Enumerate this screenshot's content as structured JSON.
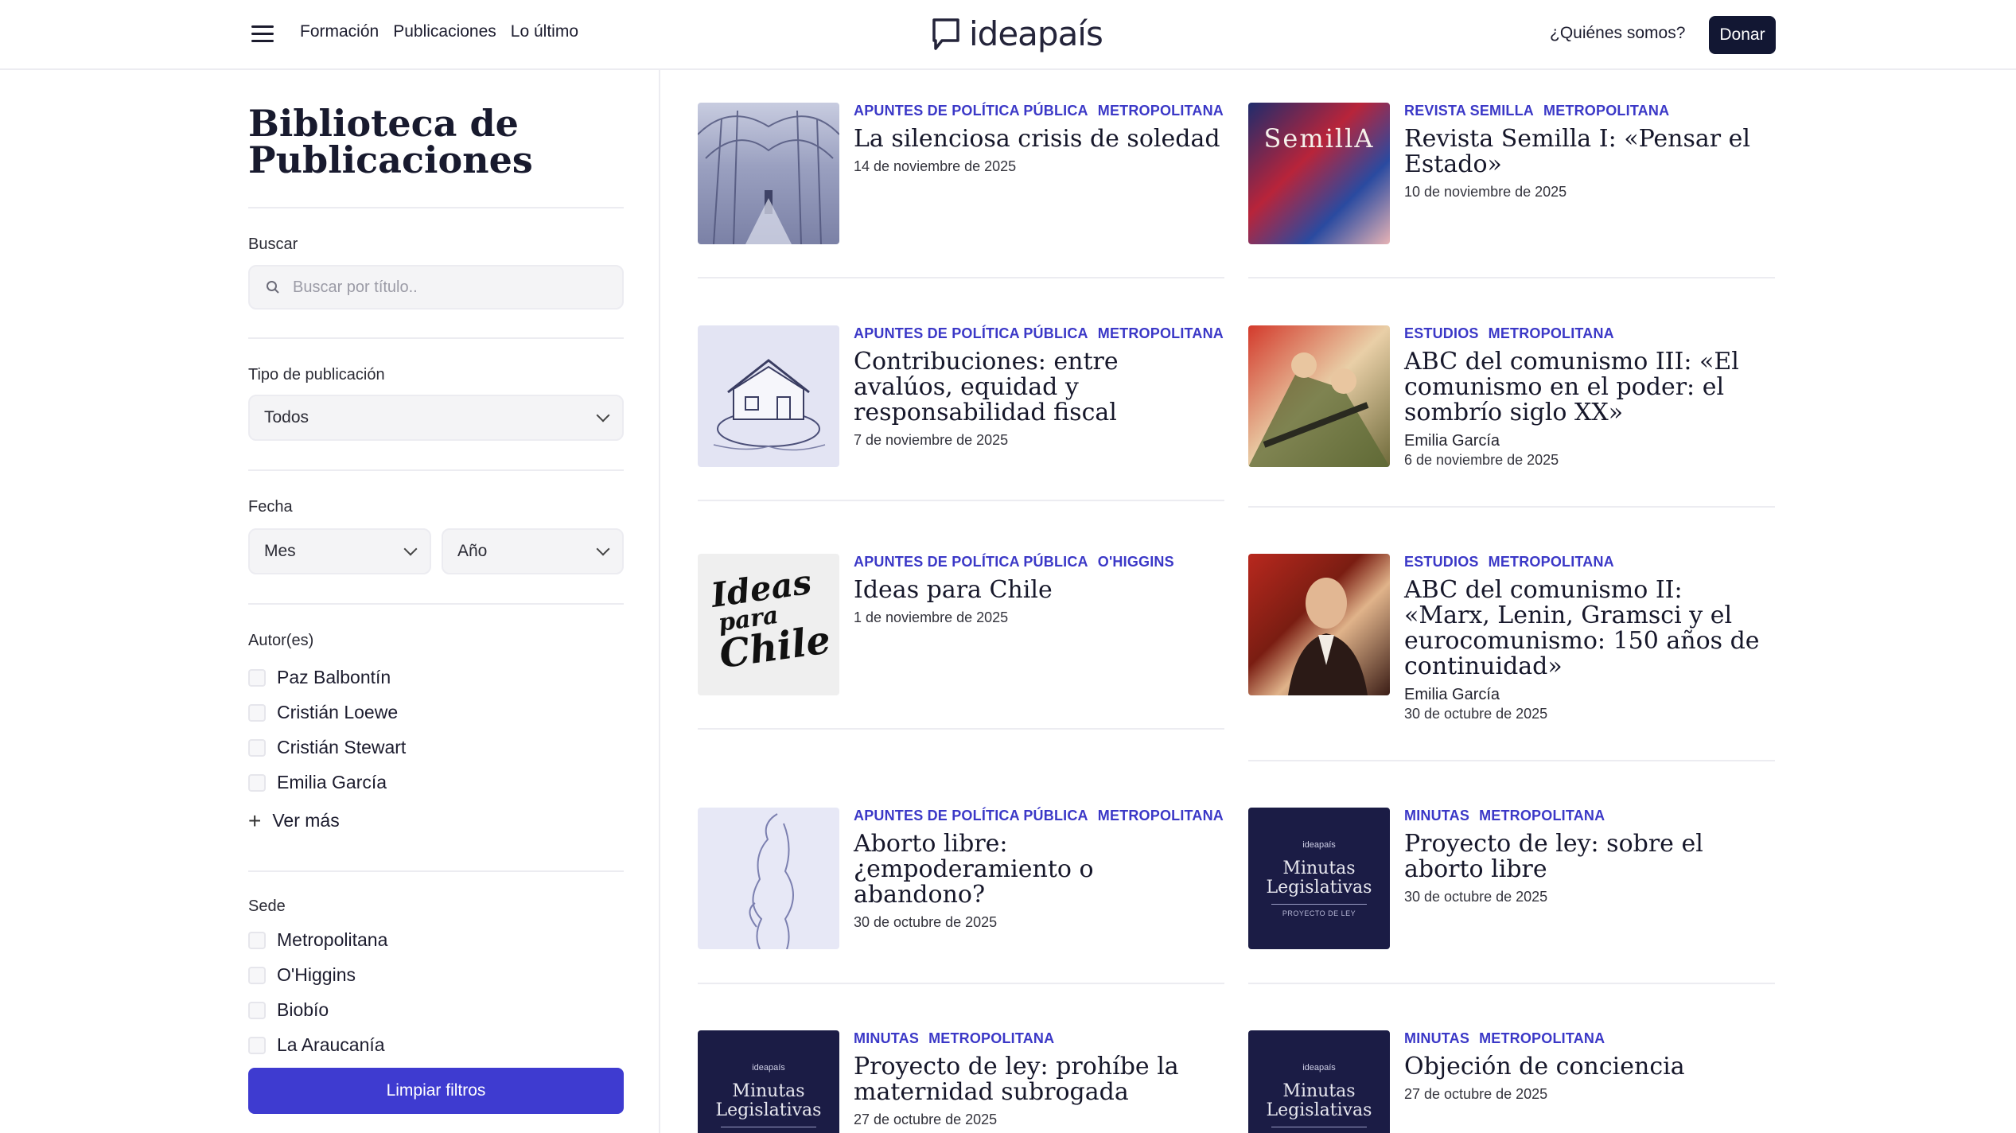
{
  "header": {
    "nav": [
      "Formación",
      "Publicaciones",
      "Lo último"
    ],
    "logo_text": "ideapaís",
    "who_label": "¿Quiénes somos?",
    "donate_label": "Donar"
  },
  "sidebar": {
    "title": "Biblioteca de Publicaciones",
    "search": {
      "label": "Buscar",
      "placeholder": "Buscar por título.."
    },
    "type": {
      "label": "Tipo de publicación",
      "value": "Todos"
    },
    "date": {
      "label": "Fecha",
      "month": "Mes",
      "year": "Año"
    },
    "authors": {
      "label": "Autor(es)",
      "items": [
        "Paz Balbontín",
        "Cristián Loewe",
        "Cristián Stewart",
        "Emilia García"
      ],
      "more_label": "Ver más"
    },
    "sede": {
      "label": "Sede",
      "items": [
        "Metropolitana",
        "O'Higgins",
        "Biobío",
        "La Araucanía"
      ]
    },
    "clear_label": "Limpiar filtros"
  },
  "publications": [
    {
      "tags": [
        "APUNTES DE POLÍTICA PÚBLICA",
        "METROPOLITANA"
      ],
      "title": "La silenciosa crisis de soledad",
      "author": "",
      "date": "14 de noviembre de 2025"
    },
    {
      "tags": [
        "REVISTA SEMILLA",
        "METROPOLITANA"
      ],
      "title": "Revista Semilla I: «Pensar el Estado»",
      "author": "",
      "date": "10 de noviembre de 2025",
      "thumb_text": "SemillA"
    },
    {
      "tags": [
        "APUNTES DE POLÍTICA PÚBLICA",
        "METROPOLITANA"
      ],
      "title": "Contribuciones: entre avalúos, equidad y responsabilidad fiscal",
      "author": "",
      "date": "7 de noviembre de 2025"
    },
    {
      "tags": [
        "ESTUDIOS",
        "METROPOLITANA"
      ],
      "title": "ABC del comunismo III: «El comunismo en el poder: el sombrío siglo XX»",
      "author": "Emilia García",
      "date": "6 de noviembre de 2025"
    },
    {
      "tags": [
        "APUNTES DE POLÍTICA PÚBLICA",
        "O'HIGGINS"
      ],
      "title": "Ideas para Chile",
      "author": "",
      "date": "1 de noviembre de 2025",
      "thumb_text": [
        "Ideas",
        "para",
        "Chile"
      ]
    },
    {
      "tags": [
        "ESTUDIOS",
        "METROPOLITANA"
      ],
      "title": "ABC del comunismo II: «Marx, Lenin, Gramsci y el eurocomunismo: 150 años de continuidad»",
      "author": "Emilia García",
      "date": "30 de octubre de 2025"
    },
    {
      "tags": [
        "APUNTES DE POLÍTICA PÚBLICA",
        "METROPOLITANA"
      ],
      "title": "Aborto libre: ¿empoderamiento o abandono?",
      "author": "",
      "date": "30 de octubre de 2025"
    },
    {
      "tags": [
        "MINUTAS",
        "METROPOLITANA"
      ],
      "title": "Proyecto de ley: sobre el aborto libre",
      "author": "",
      "date": "30 de octubre de 2025"
    },
    {
      "tags": [
        "MINUTAS",
        "METROPOLITANA"
      ],
      "title": "Proyecto de ley: prohíbe la maternidad subrogada",
      "author": "",
      "date": "27 de octubre de 2025"
    },
    {
      "tags": [
        "MINUTAS",
        "METROPOLITANA"
      ],
      "title": "Objeción de conciencia",
      "author": "",
      "date": "27 de octubre de 2025"
    }
  ],
  "minutas_thumb": {
    "logo": "ideapaís",
    "title": "Minutas Legislativas",
    "sub": "PROYECTO DE LEY"
  }
}
